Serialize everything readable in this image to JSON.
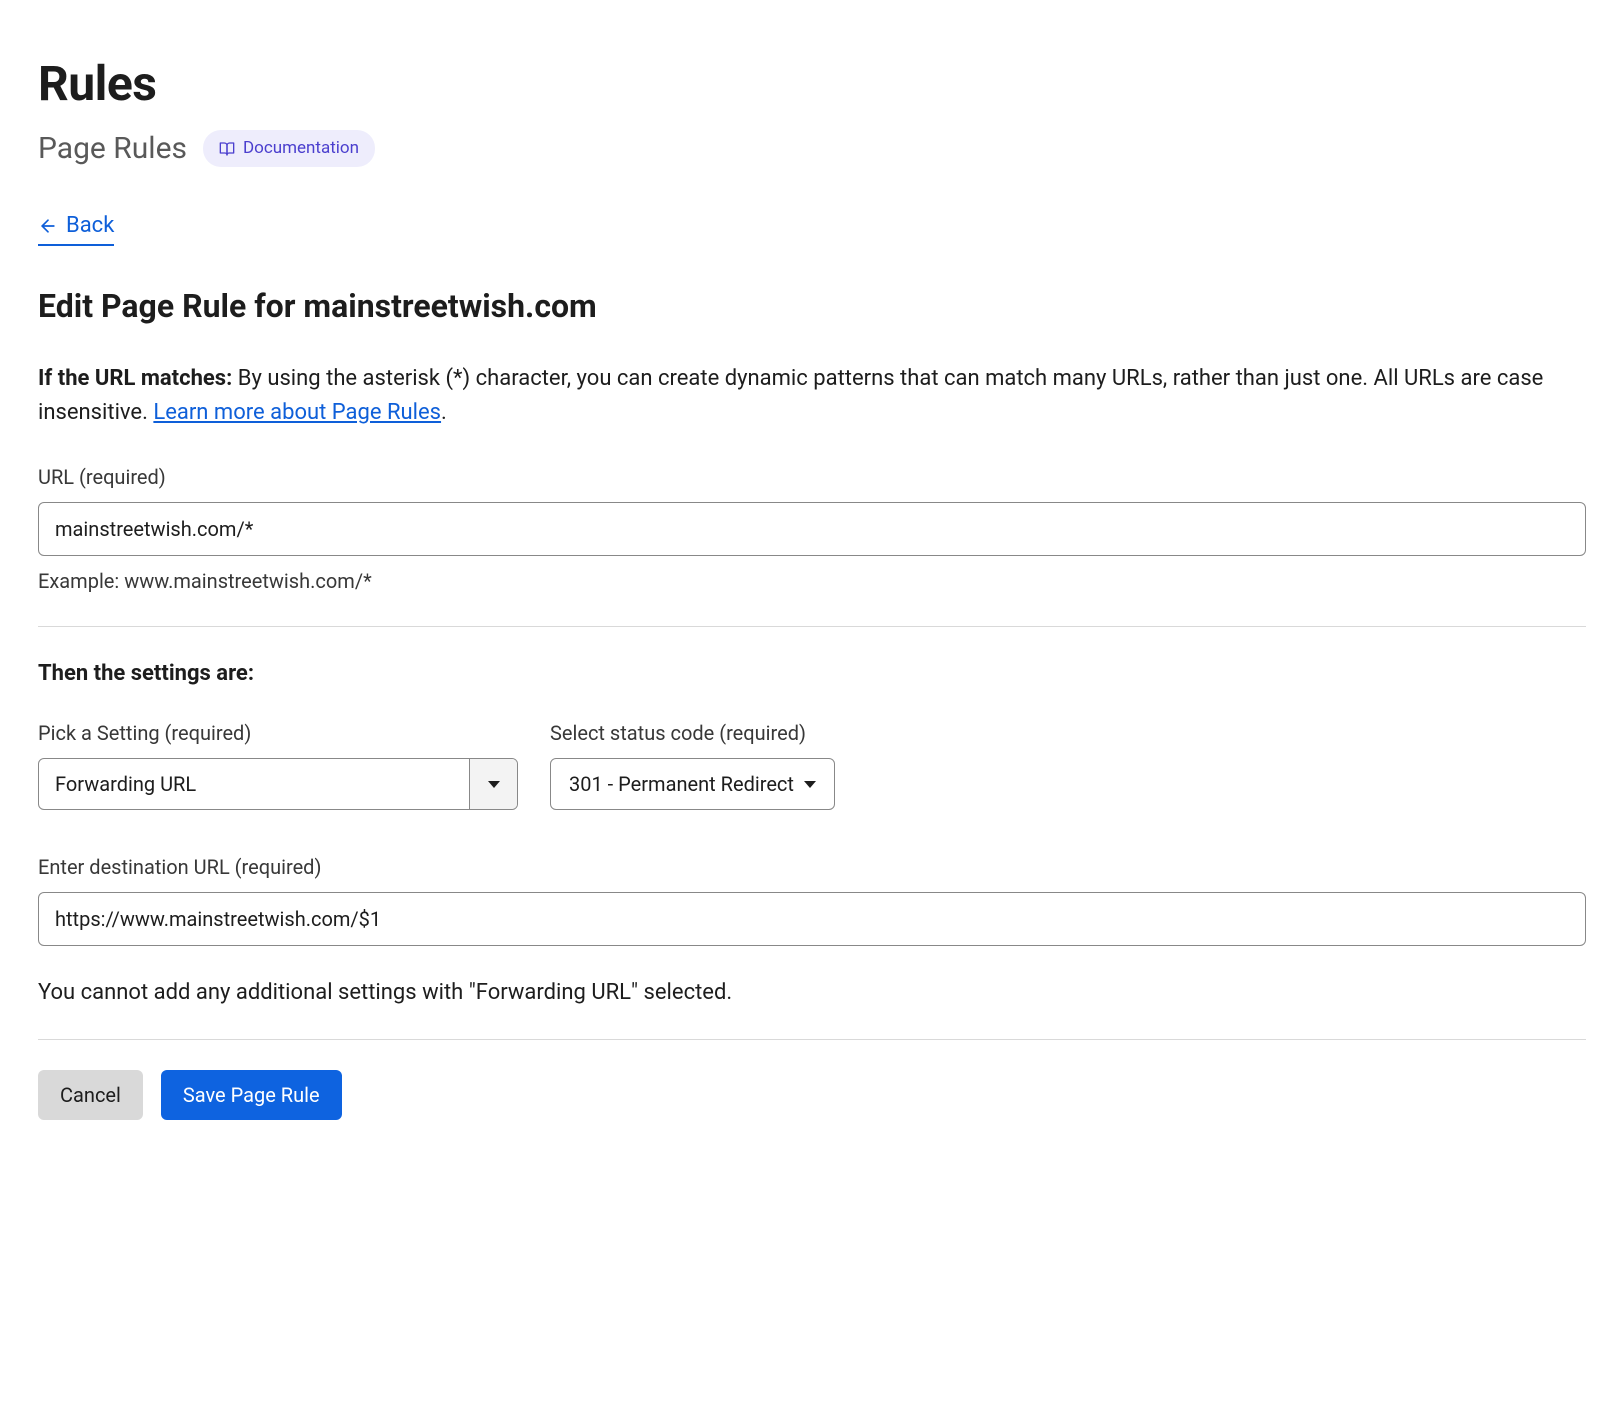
{
  "header": {
    "title": "Rules",
    "subtitle": "Page Rules",
    "documentation_label": "Documentation",
    "back_label": "Back"
  },
  "form": {
    "heading": "Edit Page Rule for mainstreetwish.com",
    "description_bold": "If the URL matches:",
    "description_rest": " By using the asterisk (*) character, you can create dynamic patterns that can match many URLs, rather than just one. All URLs are case insensitive. ",
    "learn_more_link": "Learn more about Page Rules",
    "period": ".",
    "url_label": "URL (required)",
    "url_value": "mainstreetwish.com/*",
    "url_example": "Example: www.mainstreetwish.com/*",
    "settings_heading": "Then the settings are:",
    "pick_setting_label": "Pick a Setting (required)",
    "pick_setting_value": "Forwarding URL",
    "status_code_label": "Select status code (required)",
    "status_code_value": "301 - Permanent Redirect",
    "destination_label": "Enter destination URL (required)",
    "destination_value": "https://www.mainstreetwish.com/$1",
    "forwarding_note": "You cannot add any additional settings with \"Forwarding URL\" selected.",
    "cancel_label": "Cancel",
    "save_label": "Save Page Rule"
  }
}
